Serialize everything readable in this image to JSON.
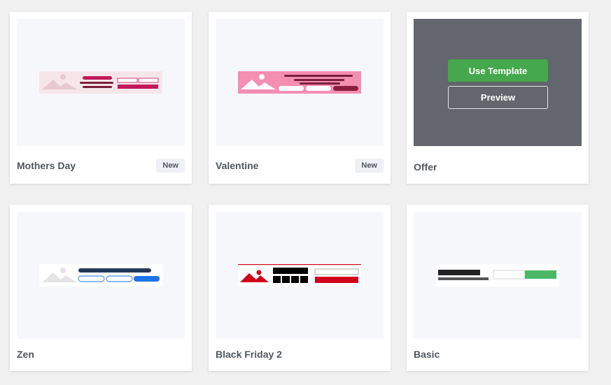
{
  "templates": [
    {
      "title": "Mothers Day",
      "badge": "New"
    },
    {
      "title": "Valentine",
      "badge": "New"
    },
    {
      "title": "Offer",
      "use_template_label": "Use Template",
      "preview_label": "Preview"
    },
    {
      "title": "Zen"
    },
    {
      "title": "Black Friday 2"
    },
    {
      "title": "Basic"
    }
  ],
  "colors": {
    "page_bg": "#f0f0f1",
    "preview_bg": "#f6f7fb",
    "overlay": "#63666c",
    "use_template_green": "#46a84c",
    "mothers_day_accent": "#c2185b",
    "valentine_pink": "#f48fb1",
    "zen_navy": "#253858",
    "zen_blue": "#1e73e8",
    "black_friday_red": "#d0021b",
    "basic_green": "#4cb866"
  }
}
